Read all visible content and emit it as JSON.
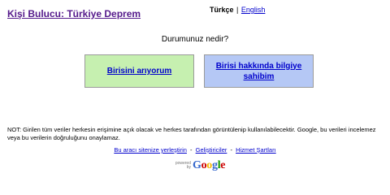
{
  "header": {
    "title": "Kişi Bulucu: Türkiye Deprem"
  },
  "language": {
    "current": "Türkçe",
    "separator": "|",
    "other": "English"
  },
  "main": {
    "question": "Durumunuz nedir?",
    "choice_seeking": "Birisini arıyorum",
    "choice_info": "Birisi hakkında bilgiye sahibim"
  },
  "notice": "NOT: Girilen tüm veriler herkesin erişimine açık olacak ve herkes tarafından görüntülenip kullanılabilecektir. Google, bu verileri incelemez veya bu verilerin doğruluğunu onaylamaz.",
  "footer": {
    "embed_link": "Bu aracı sitenize yerleştirin",
    "separator": "-",
    "developers_link": "Geliştiriciler",
    "terms_link": "Hizmet Şartları"
  },
  "branding": {
    "powered_by": "powered by",
    "logo_letters": [
      "G",
      "o",
      "o",
      "g",
      "l",
      "e"
    ],
    "logo_colors": [
      "#3366cc",
      "#cc0000",
      "#f5b800",
      "#3366cc",
      "#119900",
      "#cc0000"
    ]
  }
}
